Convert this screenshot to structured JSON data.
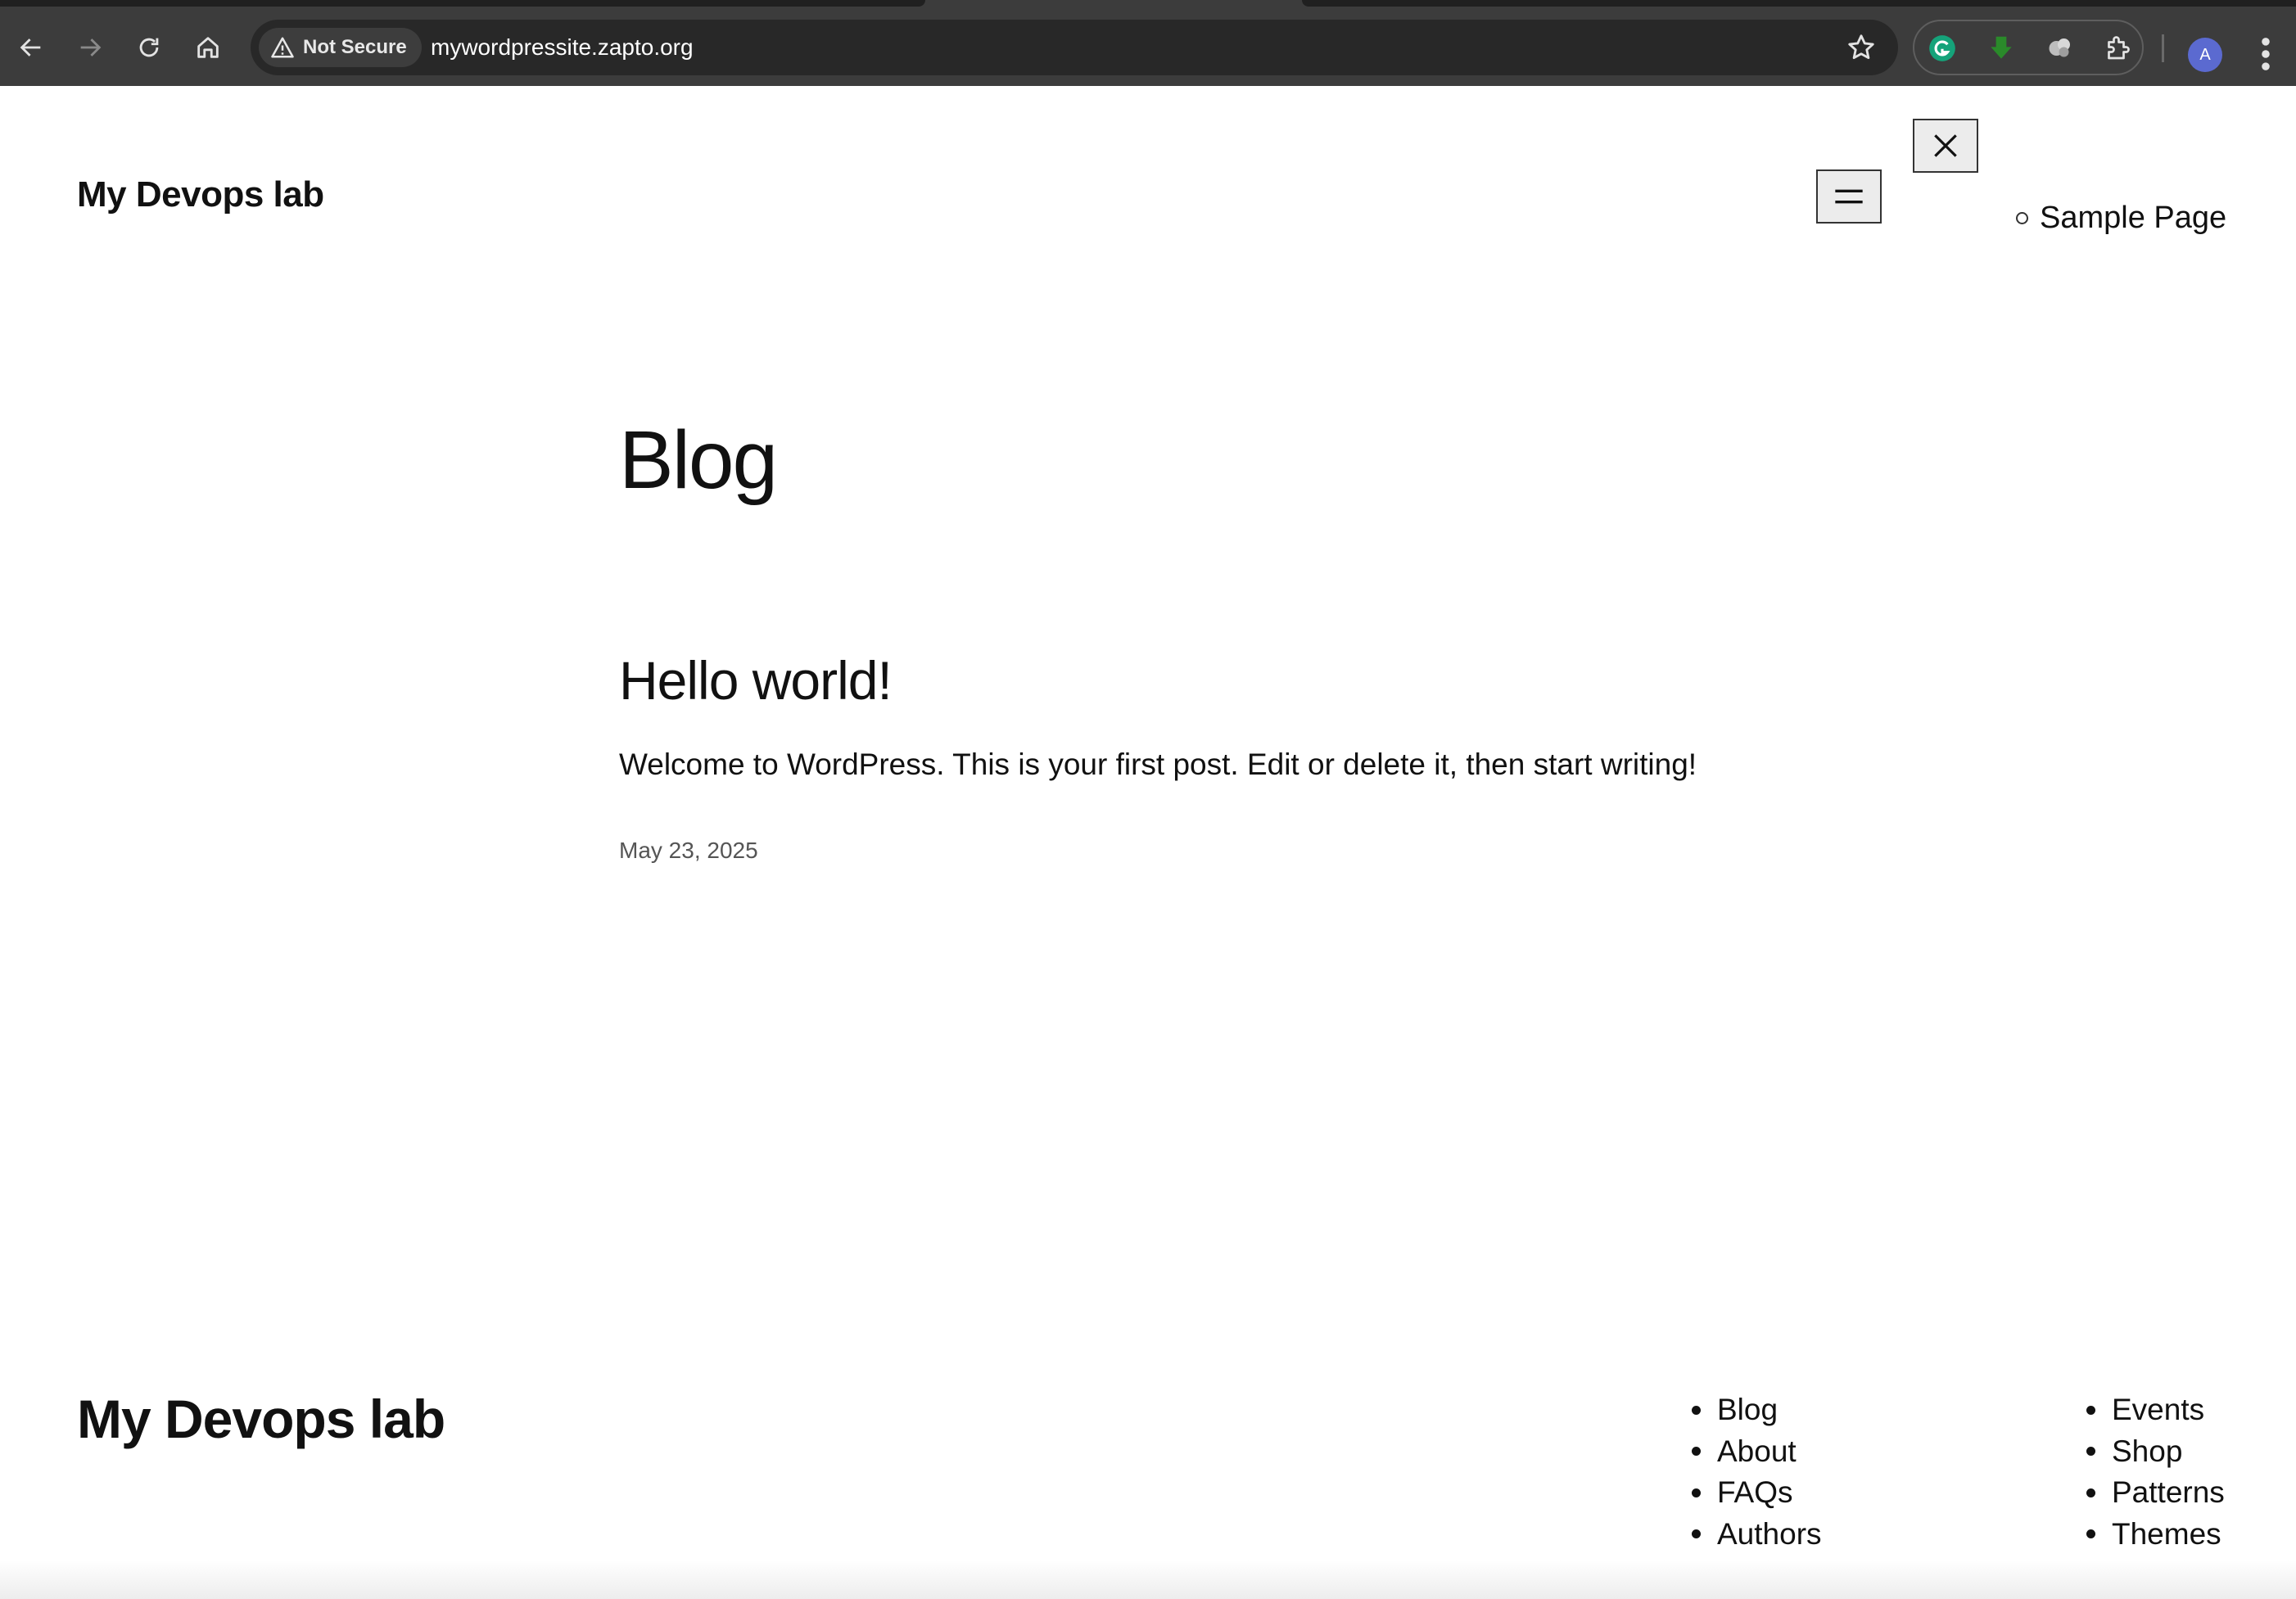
{
  "browser": {
    "security_label": "Not Secure",
    "url": "mywordpressite.zapto.org",
    "profile_initial": "A"
  },
  "site": {
    "title": "My Devops lab",
    "header_nav": [
      "Sample Page"
    ]
  },
  "main": {
    "heading": "Blog",
    "posts": [
      {
        "title": "Hello world!",
        "excerpt": "Welcome to WordPress. This is your first post. Edit or delete it, then start writing!",
        "date": "May 23, 2025"
      }
    ]
  },
  "footer": {
    "title": "My Devops lab",
    "nav_col1": [
      "Blog",
      "About",
      "FAQs",
      "Authors"
    ],
    "nav_col2": [
      "Events",
      "Shop",
      "Patterns",
      "Themes"
    ]
  },
  "icons": {
    "back": "arrow-left-icon",
    "forward": "arrow-right-icon",
    "reload": "reload-icon",
    "home": "home-icon",
    "warning": "warning-triangle-icon",
    "bookmark": "star-icon",
    "menu_open": "hamburger-icon",
    "menu_close": "close-icon"
  },
  "colors": {
    "chrome_bg": "#3c3c3c",
    "omnibox_bg": "#282828",
    "avatar_bg": "#5b6ad0",
    "page_bg": "#ffffff",
    "text": "#111111"
  }
}
